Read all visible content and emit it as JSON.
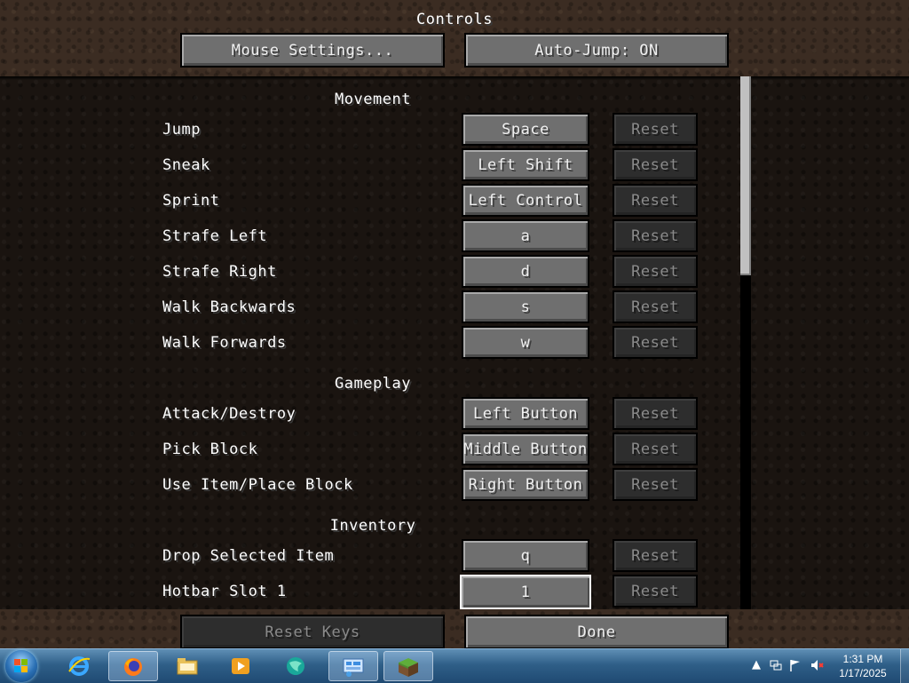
{
  "screen_title": "Controls",
  "top_buttons": {
    "mouse_settings": "Mouse Settings...",
    "auto_jump": "Auto-Jump: ON"
  },
  "sections": [
    {
      "title": "Movement",
      "bindings": [
        {
          "action": "Jump",
          "key": "Space",
          "reset": "Reset"
        },
        {
          "action": "Sneak",
          "key": "Left Shift",
          "reset": "Reset"
        },
        {
          "action": "Sprint",
          "key": "Left Control",
          "reset": "Reset"
        },
        {
          "action": "Strafe Left",
          "key": "a",
          "reset": "Reset"
        },
        {
          "action": "Strafe Right",
          "key": "d",
          "reset": "Reset"
        },
        {
          "action": "Walk Backwards",
          "key": "s",
          "reset": "Reset"
        },
        {
          "action": "Walk Forwards",
          "key": "w",
          "reset": "Reset"
        }
      ]
    },
    {
      "title": "Gameplay",
      "bindings": [
        {
          "action": "Attack/Destroy",
          "key": "Left Button",
          "reset": "Reset"
        },
        {
          "action": "Pick Block",
          "key": "Middle Button",
          "reset": "Reset"
        },
        {
          "action": "Use Item/Place Block",
          "key": "Right Button",
          "reset": "Reset"
        }
      ]
    },
    {
      "title": "Inventory",
      "bindings": [
        {
          "action": "Drop Selected Item",
          "key": "q",
          "reset": "Reset"
        },
        {
          "action": "Hotbar Slot 1",
          "key": "1",
          "reset": "Reset"
        }
      ]
    }
  ],
  "bottom_buttons": {
    "reset_keys": "Reset Keys",
    "done": "Done"
  },
  "taskbar": {
    "apps": [
      {
        "name": "internet-explorer-icon"
      },
      {
        "name": "firefox-icon"
      },
      {
        "name": "file-explorer-icon"
      },
      {
        "name": "media-player-icon"
      },
      {
        "name": "globe-app-icon"
      },
      {
        "name": "control-panel-icon"
      },
      {
        "name": "minecraft-icon"
      }
    ],
    "time": "1:31 PM",
    "date": "1/17/2025"
  },
  "colors": {
    "button_face": "#6f6f6f",
    "button_disabled": "#2d2d2d",
    "text": "#ffffff",
    "list_bg": "#1a1410"
  }
}
